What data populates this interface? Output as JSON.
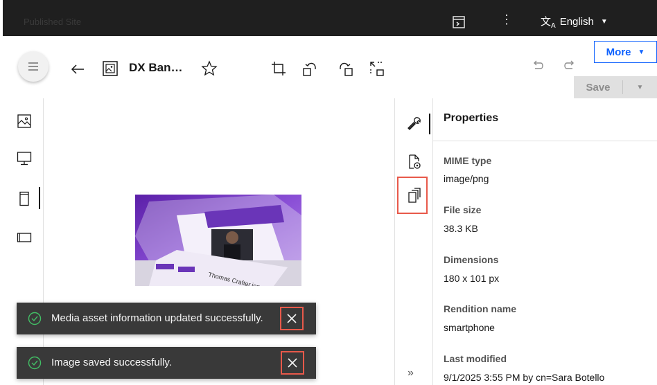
{
  "topbar": {
    "site_name": "Published Site",
    "language": "English",
    "language_icon": "translate-icon",
    "preview_icon": "preview-panel-icon",
    "kebab_icon": "overflow-menu-icon"
  },
  "toolbar": {
    "asset_title": "DX Ban…",
    "more_label": "More",
    "save_label": "Save",
    "icons": [
      "menu-icon",
      "back-arrow-icon",
      "image-icon",
      "star-icon",
      "crop-icon",
      "rotate-left-icon",
      "rotate-right-icon",
      "resize-icon",
      "undo-icon",
      "redo-icon"
    ]
  },
  "left_rail": {
    "items": [
      "image-icon",
      "desktop-icon",
      "smartphone-icon",
      "tablet-icon"
    ],
    "active_index": 2
  },
  "right_rail": {
    "items": [
      "wrench-icon",
      "file-preview-icon",
      "copy-renditions-icon"
    ],
    "active_index": 0,
    "expand_label": "»"
  },
  "properties": {
    "title": "Properties",
    "fields": [
      {
        "label": "MIME type",
        "value": "image/png"
      },
      {
        "label": "File size",
        "value": "38.3 KB"
      },
      {
        "label": "Dimensions",
        "value": "180 x 101 px"
      },
      {
        "label": "Rendition name",
        "value": "smartphone"
      },
      {
        "label": "Last modified",
        "value": "9/1/2025 3:55 PM by cn=Sara Botello"
      }
    ]
  },
  "preview": {
    "caption": "Thomas Crafter.jpg"
  },
  "toasts": [
    {
      "message": "Media asset information updated successfully."
    },
    {
      "message": "Image saved successfully."
    }
  ],
  "colors": {
    "accent": "#0f62fe",
    "highlight": "#e8594a",
    "toast_bg": "#393939",
    "success": "#42be65",
    "preview_purple": "#7b3fc4"
  }
}
